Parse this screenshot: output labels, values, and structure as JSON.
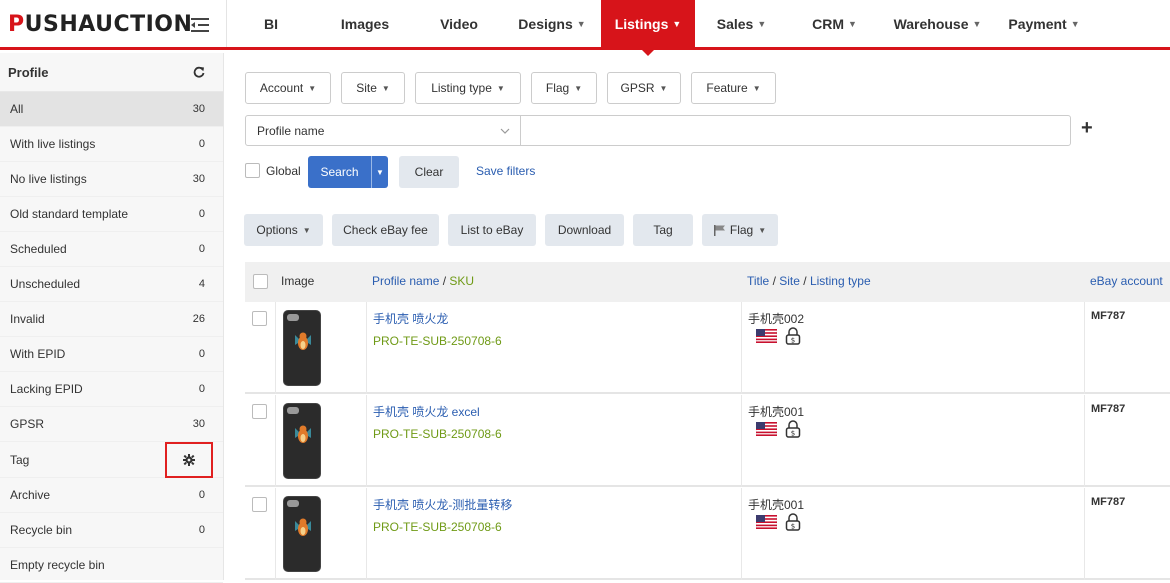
{
  "app": {
    "logo_first": "P",
    "logo_rest": "USHAUCTION"
  },
  "nav": [
    {
      "label": "BI",
      "dropdown": false
    },
    {
      "label": "Images",
      "dropdown": false
    },
    {
      "label": "Video",
      "dropdown": false
    },
    {
      "label": "Designs",
      "dropdown": true
    },
    {
      "label": "Listings",
      "dropdown": true,
      "active": true
    },
    {
      "label": "Sales",
      "dropdown": true
    },
    {
      "label": "CRM",
      "dropdown": true
    },
    {
      "label": "Warehouse",
      "dropdown": true
    },
    {
      "label": "Payment",
      "dropdown": true
    }
  ],
  "sidebar": {
    "title": "Profile",
    "items": [
      {
        "label": "All",
        "count": "30",
        "active": true
      },
      {
        "label": "With live listings",
        "count": "0"
      },
      {
        "label": "No live listings",
        "count": "30"
      },
      {
        "label": "Old standard template",
        "count": "0"
      },
      {
        "label": "Scheduled",
        "count": "0"
      },
      {
        "label": "Unscheduled",
        "count": "4"
      },
      {
        "label": "Invalid",
        "count": "26"
      },
      {
        "label": "With EPID",
        "count": "0"
      },
      {
        "label": "Lacking EPID",
        "count": "0"
      },
      {
        "label": "GPSR",
        "count": "30"
      },
      {
        "label": "Tag",
        "count": ""
      },
      {
        "label": "Archive",
        "count": "0"
      },
      {
        "label": "Recycle bin",
        "count": "0"
      },
      {
        "label": "Empty recycle bin",
        "count": ""
      }
    ]
  },
  "filters": {
    "dropdowns": [
      "Account",
      "Site",
      "Listing type",
      "Flag",
      "GPSR",
      "Feature"
    ],
    "field_select": "Profile name",
    "field_value": "",
    "global_label": "Global",
    "search_label": "Search",
    "clear_label": "Clear",
    "save_filters_label": "Save filters"
  },
  "actions": {
    "options_label": "Options",
    "check_fee_label": "Check eBay fee",
    "list_label": "List to eBay",
    "download_label": "Download",
    "tag_label": "Tag",
    "flag_label": "Flag"
  },
  "table": {
    "headers": {
      "image": "Image",
      "profile_name": "Profile name",
      "sep1": " / ",
      "sku": "SKU",
      "title": "Title",
      "sep2": " / ",
      "site": "Site",
      "sep3": " / ",
      "listing_type": "Listing type",
      "ebay_account": "eBay account"
    },
    "rows": [
      {
        "name": "手机壳 喷火龙",
        "sku": "PRO-TE-SUB-250708-6",
        "title": "手机壳002",
        "account": "MF787"
      },
      {
        "name": "手机壳 喷火龙 excel",
        "sku": "PRO-TE-SUB-250708-6",
        "title": "手机壳001",
        "account": "MF787"
      },
      {
        "name": "手机壳 喷火龙-测批量转移",
        "sku": "PRO-TE-SUB-250708-6",
        "title": "手机壳001",
        "account": "MF787"
      }
    ]
  },
  "colors": {
    "brand": "#d7141a",
    "primary": "#3a70c9",
    "link": "#2a5db0",
    "sku": "#6f9a16"
  }
}
